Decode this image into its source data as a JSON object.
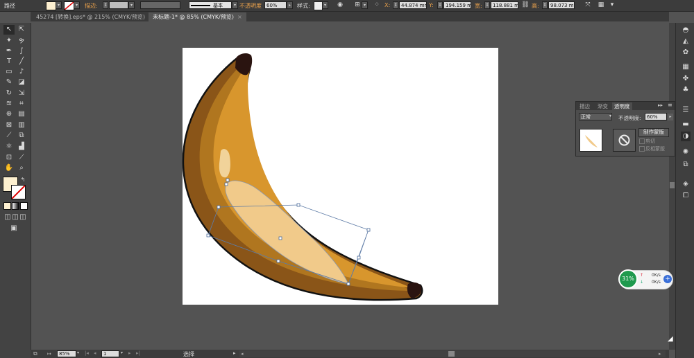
{
  "control_bar": {
    "selection_label": "路径",
    "stroke_label": "描边:",
    "brush_label": "基本",
    "opacity_label": "不透明度",
    "opacity_value": "60%",
    "style_label": "样式:",
    "x_label": "X:",
    "x_value": "44.874 mm",
    "y_label": "Y:",
    "y_value": "194.159 m",
    "w_label": "宽:",
    "w_value": "118.881 m",
    "h_label": "高:",
    "h_value": "98.073 mm"
  },
  "tabs": [
    {
      "label": "45274 [转换].eps* @ 215% (CMYK/预览)",
      "close": "×"
    },
    {
      "label": "未标题-1* @ 85% (CMYK/预览)",
      "close": "×"
    }
  ],
  "transparency_panel": {
    "tabs": [
      "描边",
      "渐变",
      "透明度"
    ],
    "blend_mode": "正常",
    "opacity_label": "不透明度:",
    "opacity_value": "60%",
    "make_mask_button": "制作蒙版",
    "clip_label": "剪切",
    "invert_label": "反相蒙版"
  },
  "status_bar": {
    "zoom": "85%",
    "page": "1",
    "tool_status": "选择"
  },
  "network_widget": {
    "percent": "31%",
    "upload": "0K/s",
    "download": "0K/s"
  },
  "colors": {
    "fill_swatch": "#fdf0d0",
    "banana_dark": "#8a5518",
    "banana_mid": "#b0761f",
    "banana_light": "#d8962d",
    "highlight": "#f1ca8a",
    "accent_orange": "#e8a04b",
    "net_green": "#1f9a4e"
  },
  "icons": [
    "selection-tool-icon",
    "direct-selection-tool-icon",
    "pen-tool-icon",
    "type-tool-icon",
    "rectangle-tool-icon",
    "brush-tool-icon",
    "eraser-tool-icon",
    "rotate-tool-icon",
    "hand-tool-icon",
    "zoom-tool-icon",
    "gradient-tool-icon",
    "eyedropper-tool-icon",
    "graph-tool-icon"
  ]
}
